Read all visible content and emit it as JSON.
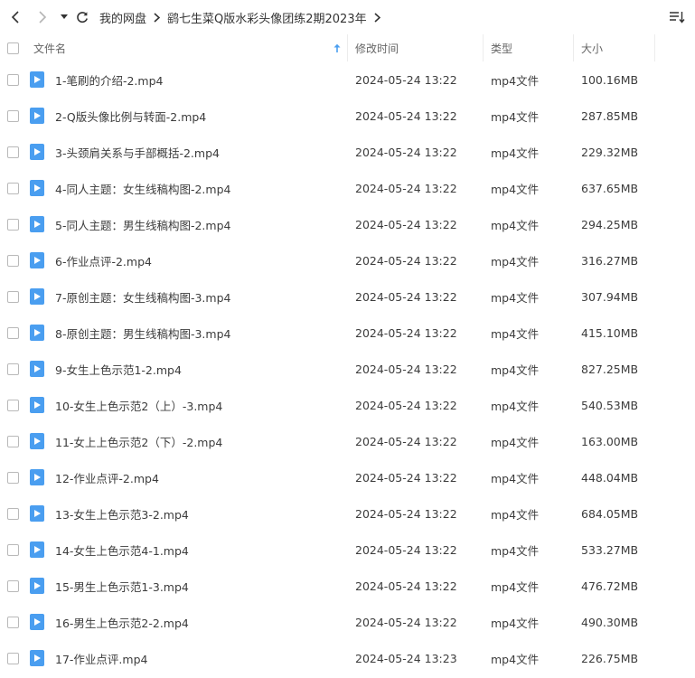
{
  "toolbar": {
    "back_icon": "chevron-left-icon",
    "forward_icon": "chevron-right-icon",
    "history_icon": "caret-down-icon",
    "refresh_icon": "refresh-icon",
    "sort_view_icon": "sort-list-icon"
  },
  "breadcrumb": {
    "items": [
      "我的网盘",
      "鹞七生菜Q版水彩头像团练2期2023年"
    ]
  },
  "columns": {
    "name": "文件名",
    "modified": "修改时间",
    "type": "类型",
    "size": "大小"
  },
  "colors": {
    "video_icon": "#4a9ef0",
    "text": "#3c3c3c",
    "header_text": "#666666",
    "sort_arrow": "#4a9ef0"
  },
  "files": [
    {
      "name": "1-笔刷的介绍-2.mp4",
      "modified": "2024-05-24 13:22",
      "type": "mp4文件",
      "size": "100.16MB"
    },
    {
      "name": "2-Q版头像比例与转面-2.mp4",
      "modified": "2024-05-24 13:22",
      "type": "mp4文件",
      "size": "287.85MB"
    },
    {
      "name": "3-头颈肩关系与手部概括-2.mp4",
      "modified": "2024-05-24 13:22",
      "type": "mp4文件",
      "size": "229.32MB"
    },
    {
      "name": "4-同人主题：女生线稿构图-2.mp4",
      "modified": "2024-05-24 13:22",
      "type": "mp4文件",
      "size": "637.65MB"
    },
    {
      "name": "5-同人主题：男生线稿构图-2.mp4",
      "modified": "2024-05-24 13:22",
      "type": "mp4文件",
      "size": "294.25MB"
    },
    {
      "name": "6-作业点评-2.mp4",
      "modified": "2024-05-24 13:22",
      "type": "mp4文件",
      "size": "316.27MB"
    },
    {
      "name": "7-原创主题：女生线稿构图-3.mp4",
      "modified": "2024-05-24 13:22",
      "type": "mp4文件",
      "size": "307.94MB"
    },
    {
      "name": "8-原创主题：男生线稿构图-3.mp4",
      "modified": "2024-05-24 13:22",
      "type": "mp4文件",
      "size": "415.10MB"
    },
    {
      "name": "9-女生上色示范1-2.mp4",
      "modified": "2024-05-24 13:22",
      "type": "mp4文件",
      "size": "827.25MB"
    },
    {
      "name": "10-女生上色示范2（上）-3.mp4",
      "modified": "2024-05-24 13:22",
      "type": "mp4文件",
      "size": "540.53MB"
    },
    {
      "name": "11-女上上色示范2（下）-2.mp4",
      "modified": "2024-05-24 13:22",
      "type": "mp4文件",
      "size": "163.00MB"
    },
    {
      "name": "12-作业点评-2.mp4",
      "modified": "2024-05-24 13:22",
      "type": "mp4文件",
      "size": "448.04MB"
    },
    {
      "name": "13-女生上色示范3-2.mp4",
      "modified": "2024-05-24 13:22",
      "type": "mp4文件",
      "size": "684.05MB"
    },
    {
      "name": "14-女生上色示范4-1.mp4",
      "modified": "2024-05-24 13:22",
      "type": "mp4文件",
      "size": "533.27MB"
    },
    {
      "name": "15-男生上色示范1-3.mp4",
      "modified": "2024-05-24 13:22",
      "type": "mp4文件",
      "size": "476.72MB"
    },
    {
      "name": "16-男生上色示范2-2.mp4",
      "modified": "2024-05-24 13:22",
      "type": "mp4文件",
      "size": "490.30MB"
    },
    {
      "name": "17-作业点评.mp4",
      "modified": "2024-05-24 13:23",
      "type": "mp4文件",
      "size": "226.75MB"
    }
  ]
}
